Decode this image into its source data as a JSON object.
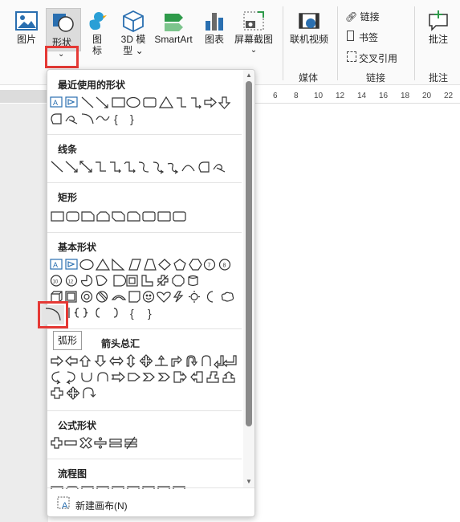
{
  "ribbon": {
    "picture_label": "图片",
    "shapes_label": "形状",
    "icons_label": "图标",
    "model3d_label": "3D 模型",
    "smartart_label": "SmartArt",
    "chart_label": "图表",
    "screenshot_label": "屏幕截图",
    "online_video_label": "联机视频",
    "media_group": "媒体",
    "link_label": "链接",
    "bookmark_label": "书签",
    "crossref_label": "交叉引用",
    "links_group": "链接",
    "comment_label": "批注",
    "comments_group": "批注"
  },
  "ruler": [
    "6",
    "8",
    "10",
    "12",
    "14",
    "16",
    "18",
    "20",
    "22"
  ],
  "menu": {
    "recent_title": "最近使用的形状",
    "lines_title": "线条",
    "rect_title": "矩形",
    "basic_title": "基本形状",
    "block_title": "箭头总汇",
    "equation_title": "公式形状",
    "flowchart_title": "流程图",
    "new_canvas": "新建画布(N)"
  },
  "tooltip": "弧形"
}
